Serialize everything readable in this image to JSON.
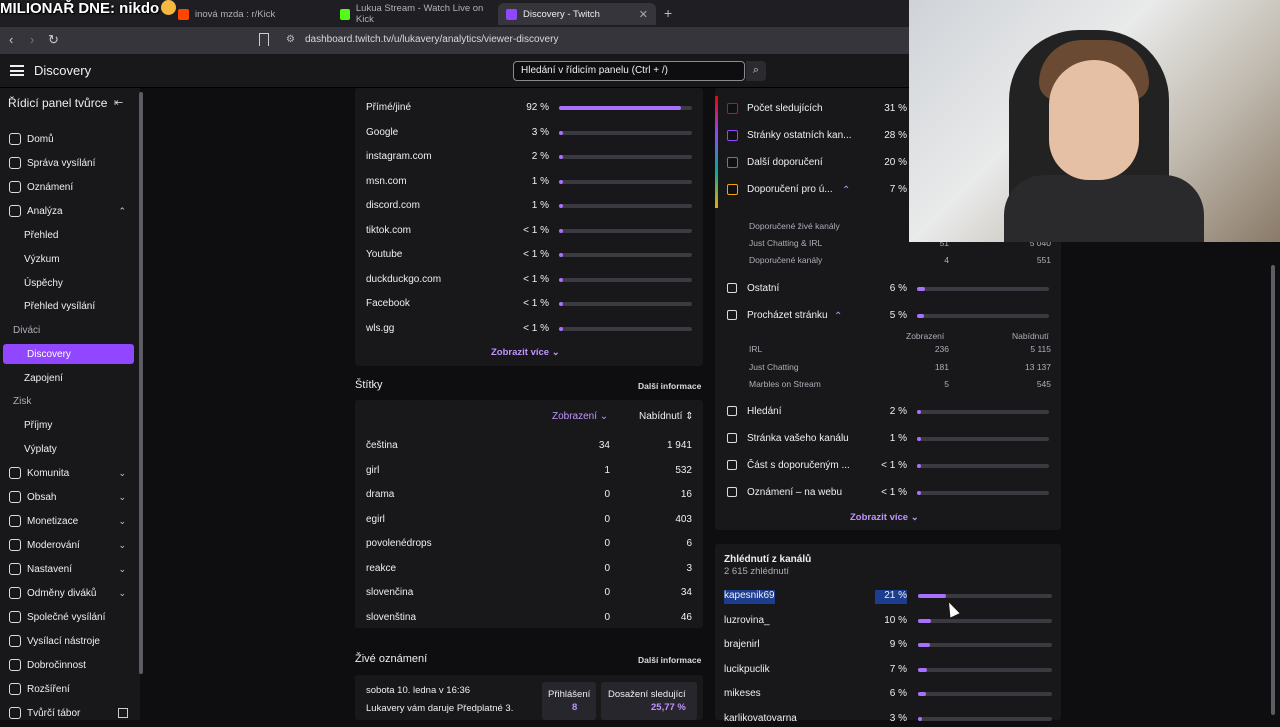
{
  "browser": {
    "overlay_text": "MILIONAŘ DNE: nikdo",
    "tabs": [
      {
        "label": "inová mzda : r/Kick",
        "color": "#ff4500"
      },
      {
        "label": "Lukua Stream - Watch Live on Kick",
        "color": "#53fc18"
      },
      {
        "label": "Discovery - Twitch",
        "color": "#9147ff"
      }
    ],
    "url": "dashboard.twitch.tv/u/lukavery/analytics/viewer-discovery"
  },
  "topnav": {
    "title": "Discovery",
    "search_placeholder": "Hledání v řídicím panelu (Ctrl + /)"
  },
  "sidebar": {
    "header": "Řídicí panel tvůrce",
    "items": [
      {
        "label": "Domů",
        "type": "top",
        "icon": "home-icon"
      },
      {
        "label": "Správa vysílání",
        "type": "top",
        "icon": "broadcast-icon"
      },
      {
        "label": "Oznámení",
        "type": "top",
        "icon": "megaphone-icon"
      },
      {
        "label": "Analýza",
        "type": "top",
        "icon": "analytics-icon",
        "expanded": true
      },
      {
        "label": "Přehled",
        "type": "sub"
      },
      {
        "label": "Výzkum",
        "type": "sub"
      },
      {
        "label": "Úspěchy",
        "type": "sub"
      },
      {
        "label": "Přehled vysílání",
        "type": "sub"
      },
      {
        "label": "Diváci",
        "type": "section"
      },
      {
        "label": "Discovery",
        "type": "sub",
        "active": true
      },
      {
        "label": "Zapojení",
        "type": "sub"
      },
      {
        "label": "Zisk",
        "type": "section"
      },
      {
        "label": "Příjmy",
        "type": "sub"
      },
      {
        "label": "Výplaty",
        "type": "sub"
      },
      {
        "label": "Komunita",
        "type": "top",
        "icon": "community-icon",
        "chev": true
      },
      {
        "label": "Obsah",
        "type": "top",
        "icon": "content-icon",
        "chev": true
      },
      {
        "label": "Monetizace",
        "type": "top",
        "icon": "monetization-icon",
        "chev": true
      },
      {
        "label": "Moderování",
        "type": "top",
        "icon": "moderation-icon",
        "chev": true
      },
      {
        "label": "Nastavení",
        "type": "top",
        "icon": "settings-icon",
        "chev": true
      },
      {
        "label": "Odměny diváků",
        "type": "top",
        "icon": "rewards-icon",
        "chev": true
      },
      {
        "label": "Společné vysílání",
        "type": "top",
        "icon": "collab-icon"
      },
      {
        "label": "Vysílací nástroje",
        "type": "top",
        "icon": "tools-icon"
      },
      {
        "label": "Dobročinnost",
        "type": "top",
        "icon": "charity-icon"
      },
      {
        "label": "Rozšíření",
        "type": "top",
        "icon": "extensions-icon"
      },
      {
        "label": "Tvůrčí tábor",
        "type": "top",
        "icon": "creator-camp-icon",
        "ext": true
      }
    ]
  },
  "external": {
    "rows": [
      {
        "name": "Přímé/jiné",
        "pct": "92 %",
        "value": 0.92
      },
      {
        "name": "Google",
        "pct": "3 %",
        "value": 0.03
      },
      {
        "name": "instagram.com",
        "pct": "2 %",
        "value": 0.02
      },
      {
        "name": "msn.com",
        "pct": "1 %",
        "value": 0.01
      },
      {
        "name": "discord.com",
        "pct": "1 %",
        "value": 0.01
      },
      {
        "name": "tiktok.com",
        "pct": "< 1 %",
        "value": 0.003
      },
      {
        "name": "Youtube",
        "pct": "< 1 %",
        "value": 0.003
      },
      {
        "name": "duckduckgo.com",
        "pct": "< 1 %",
        "value": 0.003
      },
      {
        "name": "Facebook",
        "pct": "< 1 %",
        "value": 0.003
      },
      {
        "name": "wls.gg",
        "pct": "< 1 %",
        "value": 0.003
      }
    ],
    "show_more": "Zobrazit více"
  },
  "tags": {
    "title": "Štítky",
    "more": "Další informace",
    "col_views": "Zobrazení",
    "col_follows": "Nabídnutí",
    "rows": [
      {
        "name": "čeština",
        "views": "34",
        "follows": "1 941"
      },
      {
        "name": "girl",
        "views": "1",
        "follows": "532"
      },
      {
        "name": "drama",
        "views": "0",
        "follows": "16"
      },
      {
        "name": "egirl",
        "views": "0",
        "follows": "403"
      },
      {
        "name": "povolenédrops",
        "views": "0",
        "follows": "6"
      },
      {
        "name": "reakce",
        "views": "0",
        "follows": "3"
      },
      {
        "name": "slovenčina",
        "views": "0",
        "follows": "34"
      },
      {
        "name": "slovenština",
        "views": "0",
        "follows": "46"
      }
    ]
  },
  "live_notif": {
    "title": "Živé oznámení",
    "more": "Další informace",
    "date": "sobota 10. ledna v 16:36",
    "message": "Lukavery vám daruje Předplatné 3.",
    "logins_label": "Přihlášení",
    "logins_value": "8",
    "reach_label": "Dosažení sledující",
    "reach_value": "25,77 %"
  },
  "internal": {
    "rows": [
      {
        "name": "Počet sledujících",
        "pct": "31 %",
        "color": "#eb0400"
      },
      {
        "name": "Stránky ostatních kan...",
        "pct": "28 %",
        "color": "#9147ff"
      },
      {
        "name": "Další doporučení",
        "pct": "20 %",
        "color": "#00ad96"
      },
      {
        "name": "Doporučení pro ú...",
        "pct": "7 %",
        "color": "#f0a800",
        "expanded": true
      }
    ],
    "recommend_sub": [
      {
        "name": "Doporučené živé kanály",
        "v": "",
        "n": ""
      },
      {
        "name": "Just Chatting & IRL",
        "v": "51",
        "n": "5 040"
      },
      {
        "name": "Doporučené kanály",
        "v": "4",
        "n": "551"
      }
    ],
    "other_rows": [
      {
        "name": "Ostatní",
        "pct": "6 %",
        "value": 0.06
      },
      {
        "name": "Procházet stránku",
        "pct": "5 %",
        "value": 0.05,
        "expanded": true
      }
    ],
    "browse_cols": {
      "views": "Zobrazení",
      "follows": "Nabídnutí"
    },
    "browse_sub": [
      {
        "name": "IRL",
        "v": "236",
        "n": "5 115"
      },
      {
        "name": "Just Chatting",
        "v": "181",
        "n": "13 137"
      },
      {
        "name": "Marbles on Stream",
        "v": "5",
        "n": "545"
      }
    ],
    "tail_rows": [
      {
        "name": "Hledání",
        "pct": "2 %",
        "value": 0.02
      },
      {
        "name": "Stránka vašeho kanálu",
        "pct": "1 %",
        "value": 0.01
      },
      {
        "name": "Část s doporučeným ...",
        "pct": "< 1 %",
        "value": 0.003
      },
      {
        "name": "Oznámení – na webu",
        "pct": "< 1 %",
        "value": 0.003
      }
    ],
    "show_more": "Zobrazit více"
  },
  "channels": {
    "title": "Zhlédnutí z kanálů",
    "subtitle": "2 615 zhlédnutí",
    "rows": [
      {
        "name": "kapesnik69",
        "pct": "21 %",
        "value": 0.21,
        "selected": true
      },
      {
        "name": "luzrovina_",
        "pct": "10 %",
        "value": 0.1
      },
      {
        "name": "brajenirl",
        "pct": "9 %",
        "value": 0.09
      },
      {
        "name": "lucikpuclik",
        "pct": "7 %",
        "value": 0.07
      },
      {
        "name": "mikeses",
        "pct": "6 %",
        "value": 0.06
      },
      {
        "name": "karlikovatovarna",
        "pct": "3 %",
        "value": 0.03
      }
    ]
  }
}
